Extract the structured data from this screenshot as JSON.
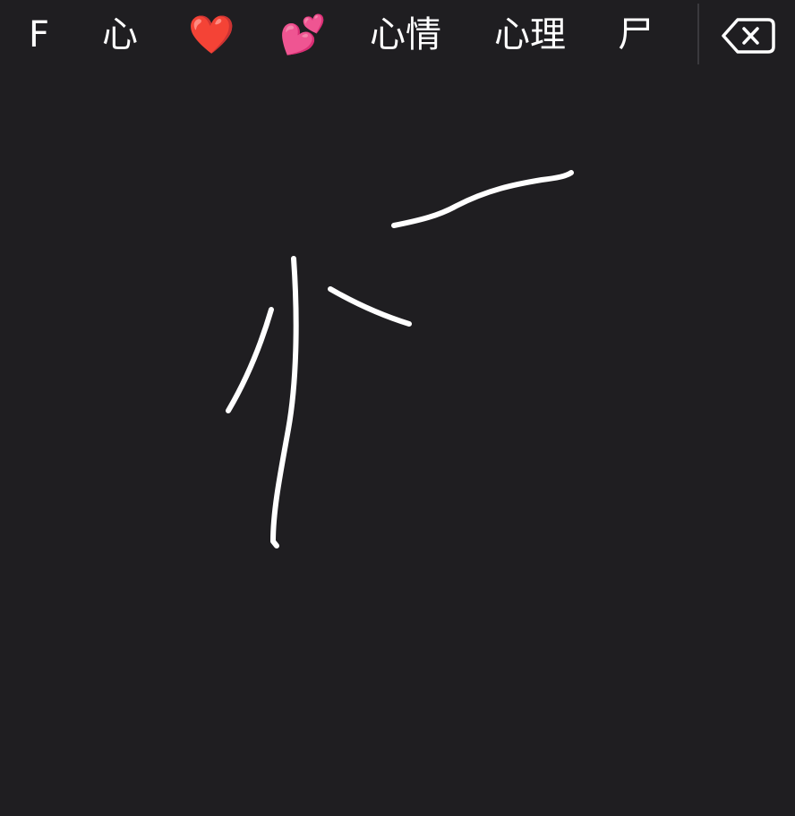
{
  "candidates": [
    "F",
    "心",
    "❤️",
    "💕",
    "心情",
    "心理",
    "尸"
  ],
  "icons": {
    "backspace": "backspace-icon"
  },
  "colors": {
    "background": "#1f1e21",
    "text": "#ffffff",
    "ink": "#ffffff",
    "divider": "#3a393d"
  }
}
